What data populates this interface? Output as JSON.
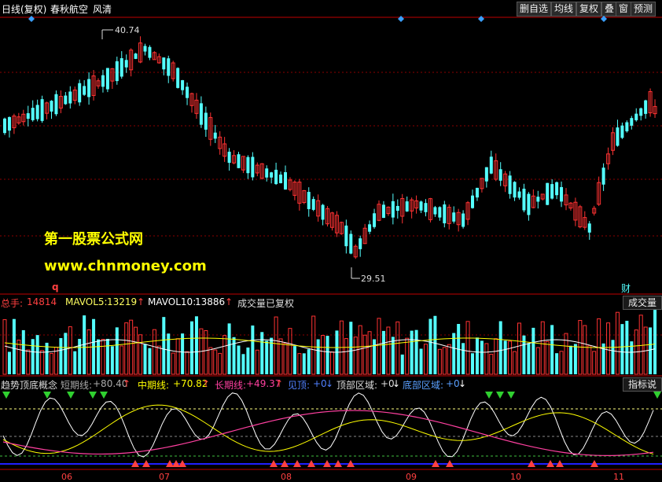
{
  "header": {
    "period": "日线(复权)",
    "stock_name": "春秋航空",
    "template": "风清",
    "toolbar": [
      "删自选",
      "均线",
      "复权",
      "叠",
      "窗",
      "预测"
    ]
  },
  "price_chart": {
    "high_label": "40.74",
    "low_label": "29.51",
    "marker_q": "q",
    "marker_cai": "财"
  },
  "watermark": {
    "line1": "第一股票公式网",
    "line2": "www.chnmoney.com"
  },
  "volume_bar": {
    "total_label": "总手:",
    "total_value": "14814",
    "mavol5_label": "MAVOL5:",
    "mavol5_value": "13219",
    "mavol10_label": "MAVOL10:",
    "mavol10_value": "13886",
    "note": "成交量已复权",
    "right_button": "成交量"
  },
  "indicator_bar": {
    "name": "趋势顶底概念",
    "short_label": "短期线:",
    "short_value": "+80.40",
    "mid_label": "中期线:",
    "mid_value": "+70.82",
    "long_label": "长期线:",
    "long_value": "+49.37",
    "top_label": "见顶:",
    "top_value": "+0",
    "toparea_label": "顶部区域:",
    "toparea_value": "+0",
    "bottomarea_label": "底部区域:",
    "bottomarea_value": "+0",
    "right_button": "指标说"
  },
  "x_axis": {
    "months": [
      "06",
      "07",
      "08",
      "09",
      "10",
      "11"
    ]
  },
  "colors": {
    "up": "#ff3232",
    "down": "#54ffff",
    "white_line": "#ffffff",
    "yellow_line": "#ffff00",
    "magenta_line": "#ff40a0"
  }
}
